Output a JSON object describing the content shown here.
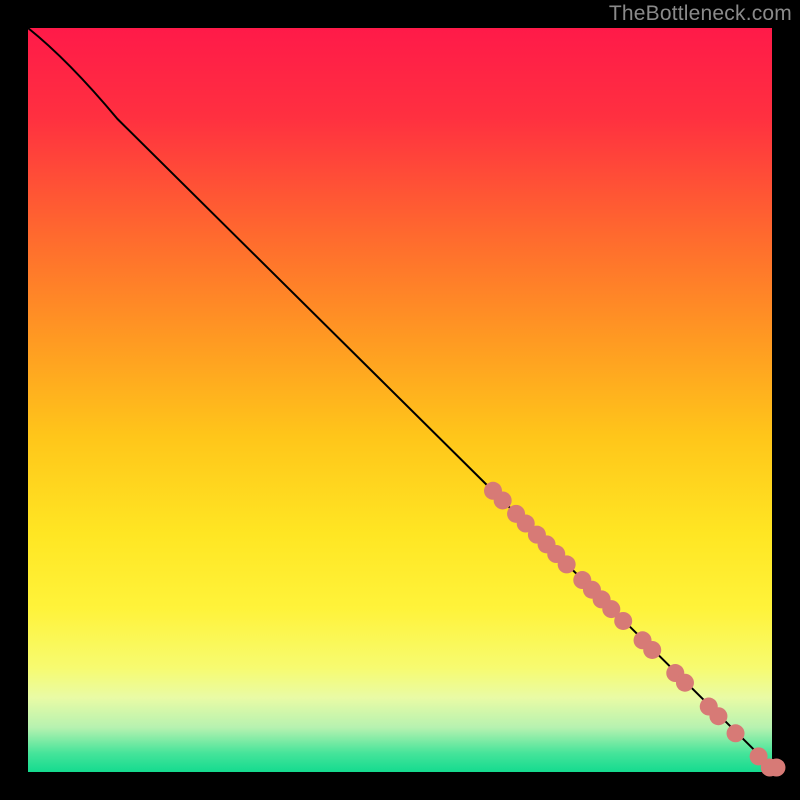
{
  "credit": "TheBottleneck.com",
  "chart_data": {
    "type": "line",
    "title": "",
    "xlabel": "",
    "ylabel": "",
    "xlim": [
      0,
      100
    ],
    "ylim": [
      0,
      100
    ],
    "axes_visible": false,
    "grid": false,
    "background_gradient": [
      {
        "offset": 0.0,
        "color": "#ff1a49"
      },
      {
        "offset": 0.12,
        "color": "#ff3040"
      },
      {
        "offset": 0.28,
        "color": "#ff6a2e"
      },
      {
        "offset": 0.42,
        "color": "#ff9a22"
      },
      {
        "offset": 0.55,
        "color": "#ffc61a"
      },
      {
        "offset": 0.68,
        "color": "#ffe623"
      },
      {
        "offset": 0.78,
        "color": "#fff33a"
      },
      {
        "offset": 0.86,
        "color": "#f7fb70"
      },
      {
        "offset": 0.9,
        "color": "#e9fba5"
      },
      {
        "offset": 0.94,
        "color": "#b7f2b0"
      },
      {
        "offset": 0.975,
        "color": "#45e49a"
      },
      {
        "offset": 1.0,
        "color": "#14db8f"
      }
    ],
    "curve": {
      "name": "bottleneck-curve",
      "points_xy": [
        [
          0.0,
          100.0
        ],
        [
          4.0,
          96.8
        ],
        [
          8.0,
          92.6
        ],
        [
          12.0,
          87.8
        ],
        [
          100.0,
          0.6
        ]
      ]
    },
    "markers": {
      "name": "sample-points",
      "color": "#d77a76",
      "radius_px": 9,
      "points_xy": [
        [
          62.5,
          37.8
        ],
        [
          63.8,
          36.5
        ],
        [
          65.6,
          34.7
        ],
        [
          66.9,
          33.4
        ],
        [
          68.4,
          31.9
        ],
        [
          69.7,
          30.6
        ],
        [
          71.0,
          29.3
        ],
        [
          72.4,
          27.9
        ],
        [
          74.5,
          25.8
        ],
        [
          75.8,
          24.5
        ],
        [
          77.1,
          23.2
        ],
        [
          78.4,
          21.9
        ],
        [
          80.0,
          20.3
        ],
        [
          82.6,
          17.7
        ],
        [
          83.9,
          16.4
        ],
        [
          87.0,
          13.3
        ],
        [
          88.3,
          12.0
        ],
        [
          91.5,
          8.8
        ],
        [
          92.8,
          7.5
        ],
        [
          95.1,
          5.2
        ],
        [
          98.2,
          2.1
        ],
        [
          99.7,
          0.6
        ],
        [
          100.6,
          0.6
        ]
      ]
    }
  }
}
